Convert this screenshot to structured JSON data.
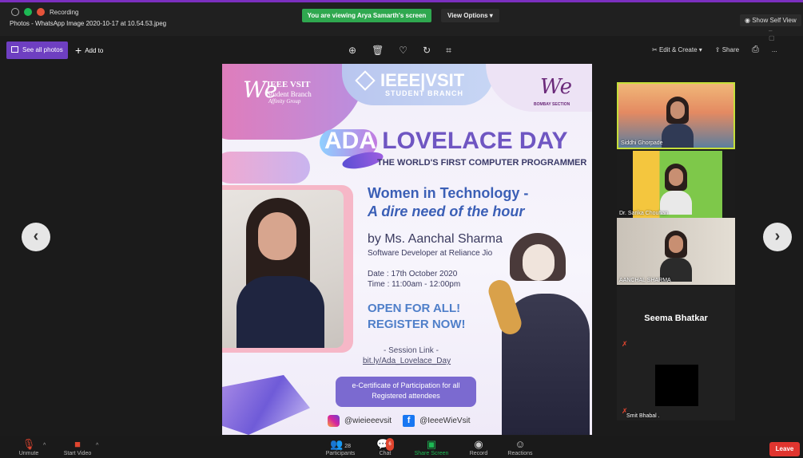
{
  "window": {
    "recording_label": "Recording",
    "title": "Photos - WhatsApp Image 2020-10-17 at 10.54.53.jpeg"
  },
  "zoom_top": {
    "share_banner": "You are viewing Arya Samarth's screen",
    "view_options": "View Options",
    "show_self_view": "Show Self View"
  },
  "photos_toolbar": {
    "see_all": "See all photos",
    "add_to": "Add to",
    "icons": [
      "zoom-in-icon",
      "delete-icon",
      "favorite-icon",
      "rotate-icon",
      "crop-icon"
    ],
    "edit_create": "Edit & Create",
    "share": "Share",
    "more": "..."
  },
  "poster": {
    "wie_we": "We",
    "wie_line1": "IEEE VSIT",
    "wie_line2": "Student Branch",
    "wie_line3": "Affinity Group",
    "ieee_main": "IEEE|VSIT",
    "ieee_sub": "STUDENT BRANCH",
    "bombay_we": "We",
    "bombay_tag": "BOMBAY SECTION",
    "title_ada": "ADA",
    "title_rest": "LOVELACE DAY",
    "subtitle": "THE WORLD'S FIRST COMPUTER PROGRAMMER",
    "headline1": "Women in Technology -",
    "headline2": "A dire need of the hour",
    "speaker": "by Ms. Aanchal Sharma",
    "speaker_role": "Software Developer at Reliance Jio",
    "date": "Date : 17th October 2020",
    "time": "Time : 11:00am - 12:00pm",
    "cta1": "OPEN FOR ALL!",
    "cta2": "REGISTER NOW!",
    "session_label": "- Session Link -",
    "session_link": "bit.ly/Ada_Lovelace_Day",
    "certificate": "e-Certificate of Participation for all Registered attendees",
    "instagram": "@wieieeevsit",
    "facebook": "@IeeeWieVsit"
  },
  "participants": [
    {
      "name": "Siddhi Ghorpade"
    },
    {
      "name": "Dr. Sarika Chouhan"
    },
    {
      "name": "AANCHAL SHARMA"
    },
    {
      "name": "Seema Bhatkar"
    },
    {
      "name": "Smit Bhabal ."
    }
  ],
  "bottom_bar": {
    "unmute": "Unmute",
    "start_video": "Start Video",
    "participants": "Participants",
    "participants_count": "28",
    "chat": "Chat",
    "chat_badge": "6",
    "share_screen": "Share Screen",
    "record": "Record",
    "reactions": "Reactions",
    "leave": "Leave"
  },
  "colors": {
    "accent": "#6e3fc1",
    "share_green": "#2fa84f",
    "leave_red": "#e0352f",
    "active_speaker": "#c6df3a"
  }
}
